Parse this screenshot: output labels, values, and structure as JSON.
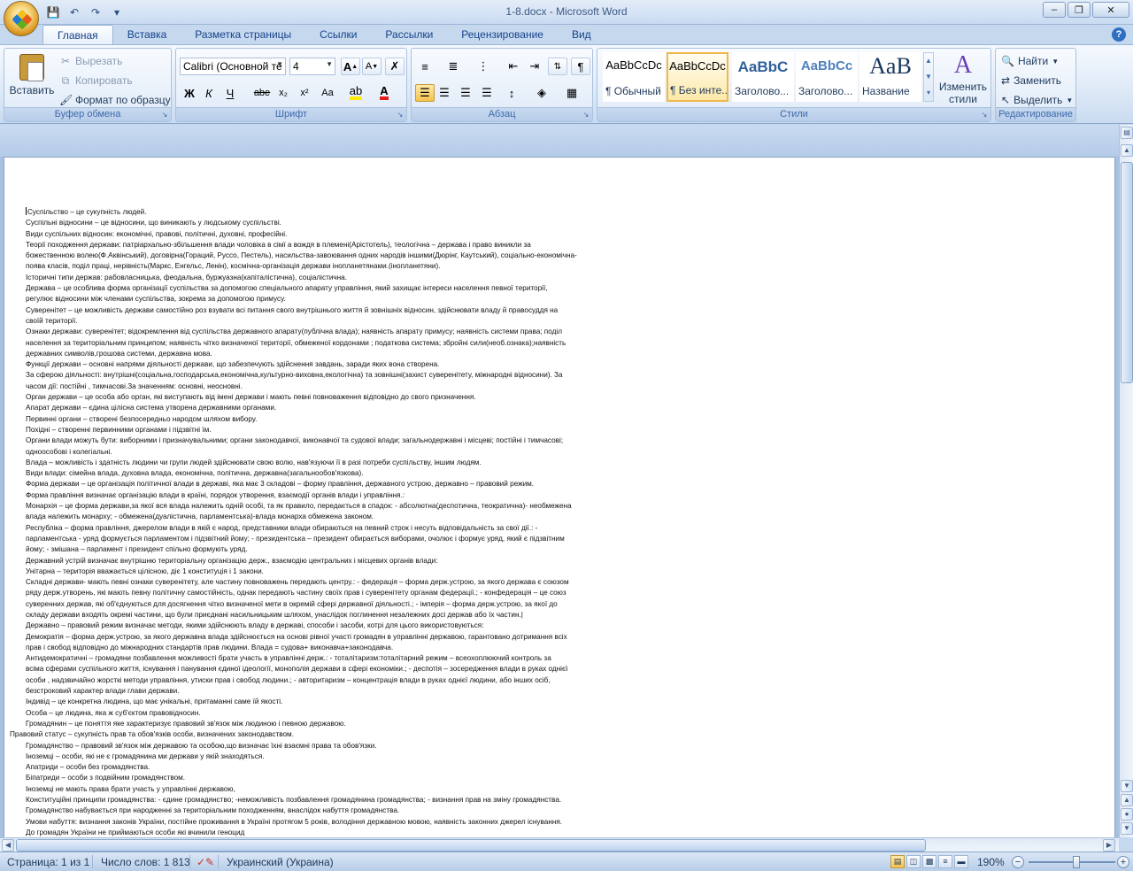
{
  "window": {
    "title": "1-8.docx - Microsoft Word",
    "controls": {
      "minimize": "–",
      "maximize": "❐",
      "close": "✕"
    }
  },
  "quick_access": [
    "save-icon",
    "undo-icon",
    "redo-icon",
    "customize-icon"
  ],
  "tabs": [
    "Главная",
    "Вставка",
    "Разметка страницы",
    "Ссылки",
    "Рассылки",
    "Рецензирование",
    "Вид"
  ],
  "active_tab": "Главная",
  "ribbon": {
    "clipboard": {
      "label": "Буфер обмена",
      "paste": "Вставить",
      "cut": "Вырезать",
      "copy": "Копировать",
      "format_painter": "Формат по образцу"
    },
    "font": {
      "label": "Шрифт",
      "font_name": "Calibri (Основной те",
      "font_size": "4",
      "bold": "Ж",
      "italic": "К",
      "underline": "Ч",
      "strike": "abe",
      "subscript": "x₂",
      "superscript": "x²",
      "change_case": "Aa",
      "grow": "A",
      "shrink": "A"
    },
    "paragraph": {
      "label": "Абзац"
    },
    "styles": {
      "label": "Стили",
      "items": [
        {
          "sample": "AaBbCcDc",
          "name": "¶ Обычный"
        },
        {
          "sample": "AaBbCcDc",
          "name": "¶ Без инте..."
        },
        {
          "sample": "AaBbC",
          "name": "Заголово..."
        },
        {
          "sample": "AaBbCc",
          "name": "Заголово..."
        },
        {
          "sample": "AaB",
          "name": "Название"
        }
      ],
      "change_styles": "Изменить стили"
    },
    "editing": {
      "label": "Редактирование",
      "find": "Найти",
      "replace": "Заменить",
      "select": "Выделить"
    }
  },
  "document": {
    "lines": [
      "Суспільство – це сукупність людей.",
      "Суспільні відносини – це відносини, що виникають у людському суспільстві.",
      "Види суспільних відносин: економічні, правові, політичні, духовні, професійні.",
      "Теорії походження держави: патріархально-збільшення влади чоловіка в сімї а вождя в племені(Арістотель), теологічна – держава і право виникли за",
      "божественною волею(Ф.Аквінський), договірна(Гораций, Руссо, Пестель), насильства-завоювання одних народів іншими(Дюрінг, Каутський), соціально-економічна-",
      "поява класів, поділ праці, нерівність(Маркс, Енгельс, Ленін), космічна-організація держави інопланетянами.(інопланетяни).",
      "Історичні типи держав: рабовласницька, феодальна, буржуазна(капіталістична), соціалістична.",
      "Держава – це особлива форма організації суспільства за допомогою спеціального апарату управління, який захищає інтереси населення певної території,",
      "регулює відносини між членами суспільства, зокрема за допомогою примусу.",
      "Суверенітет – це можливість держави самостійно роз взувати всі питання свого внутрішнього життя й зовнішніх відносин, здійснювати владу й правосуддя на",
      "своїй території.",
      "Ознаки держави: суверенітет; відокремлення від суспільства державного апарату(публічна влада); наявність апарату примусу; наявність системи права; поділ",
      "населення за територіальним принципом; наявність чітко визначеної території, обмеженої кордонами ; податкова система; збройні сили(необ.ознака);наявність",
      "державних символів,грошова системи, державна мова.",
      "Функції держави – основні напрями діяльності держави, що забезпечують здійснення завдань, заради яких вона створена.",
      "За сферою діяльності: внутрішні(соціальна,господарська,економічна,культурно-виховна,екологічна) та зовнішні(захист суверенітету, міжнародні відносини). За",
      "часом дії: постійні , тимчасові.За значенням: основні, неосновні.",
      "Орган держави – це особа або орган, які виступають від імені держави і мають певні повноваження відповідно до свого призначення.",
      "Апарат держави – єдина цілісна система утворена державними органами.",
      "Первинні органи – створені безпосередньо народом шляхом вибору.",
      "Похідні – створенні первинними органами і підзвітні їм.",
      "Органи влади можуть бути: виборними і призначувальними; органи законодавчої, виконавчої та судової влади; загальнодержавні і місцеві; постійні і тимчасові;",
      "одноособові і колегіальні.",
      "Влада – можливість і здатність людини чи групи людей здійснювати свою волю, нав'язуючи її в разі потреби суспільству, іншим людям.",
      "Види влади: сімейна влада, духовна влада, економічна, політична, державна(загальнообов'язкова).",
      "Форма держави – це організація політичної влади в державі, яка має 3 складові – форму правління, державного устрою, державно – правовий режим.",
      "Форма правління визначає організацію влади в країні, порядок утворення, взаємодії органів влади і управління.:",
      "Монархія – це форма держави,за якої вся влада належить одній особі, та як правило, передається в спадок: - абсолютна(деспотична, теократична)- необмежена",
      "влада належить монарху; - обмежена(дуалістична, парламентська)-влада монарха обмежена законом.",
      "Республіка – форма правління, джерелом влади в якій є народ, представники влади обираються на певний строк і несуть відповідальність за свої дії.: -",
      "парламентська - уряд формується парламентом і підзвітний йому; - президентська – президент обирається виборами, очолює і формує уряд, який є підзвітним",
      "йому; - змішана – парламент і президент спільно формують уряд.",
      "Державний устрій визначає внутрішню територіальну організацію держ., взаємодію центральних і місцевих органів влади:",
      "Унітарна – територія вважається цілісною, діє 1 конституція і 1 закони.",
      "Складні держави- мають певні ознаки суверенітету, але частину повноважень передають центру.: - федерація – форма держ.устрою, за якого держава є союзом",
      "ряду держ.утворень, які мають певну політичну самостійність, однак передають частину своїх прав і суверенітету органам федерації.; - конфедерація – це союз",
      "суверенних держав, які об'єднуються для досягнення чітко визначеної мети в окремій сфері державної діяльності.; - імперія – форма держ.устрою, за якої до",
      "складу держави входять окремі частини, що були приєднані насильницьким шляхом, унаслідок поглинення незалежних досі держав або їх частин.|",
      "Державно – правовий режим визначає методи, якими здійснюють владу в державі, способи і засоби, котрі для цього використовуються:",
      "Демократія – форма держ.устрою, за якого державна влада здійснюється на основі рівної участі громадян в управлінні державою, гарантовано дотримання всіх",
      "прав і свобод відповідно до міжнародних стандартів прав людини. Влада = судова+ виконавча+законодавча.",
      "Антидемократичні – громадяни позбавлення можливості брати участь в управлінні держ.: - тоталітаризм:тоталітарний режим – всеохоплюючий контроль за",
      "всіма сферами суспільного життя, існування і панування єдиної ідеології, монополія держави в сфері економіки.; - деспотія – зосередження влади в руках однієї",
      "особи , надзвичайно жорсткі методи управління, утиски прав і свобод людини.; - авторитаризм – концентрація влади в руках однієї людини, або інших осіб,",
      "безстроковий характер влади глави держави.",
      "Індивід – це конкретна людина, що має унікальні, притаманні саме їй якості.",
      "Особа – це людина, яка ж суб'єктом правовідносин.",
      "Громадянин – це поняття яке характеризує правовий зв'язок між людиною і певною державою.",
      "Правовий статус – сукупність прав та обов'язків особи, визначених законодавством.",
      "Громадянство – правовий зв'язок між державою та особою,що визначає їхні взаємні права та обов'язки.",
      "Іноземці – особи, які не є громадянина ми держави у якій знаходяться.",
      "Апатриди – особи без громадянства.",
      "Біпатриди – особи з подвійним громадянством.",
      "Іноземці не мають права брати участь у управлінні державою,",
      "Конституційні принципи громадянства: - єдине громадянство; -неможливість позбавлення громадянина громадянства; - визнання прав на зміну громадянства.",
      "Громадянство набувається при народженні за територіальним походженням, внаслідок набуття громадянства.",
      "Умови набуття: визнання законів України, постійне проживання в Україні протягом 5 років, володіння державною мовою, наявність законних джерел існування.",
      "До громадян України не приймаються особи які вчинили геноцид"
    ]
  },
  "status": {
    "page": "Страница: 1 из 1",
    "words": "Число слов: 1 813",
    "language": "Украинский (Украина)",
    "zoom": "190%",
    "zoom_minus": "−",
    "zoom_plus": "+"
  }
}
